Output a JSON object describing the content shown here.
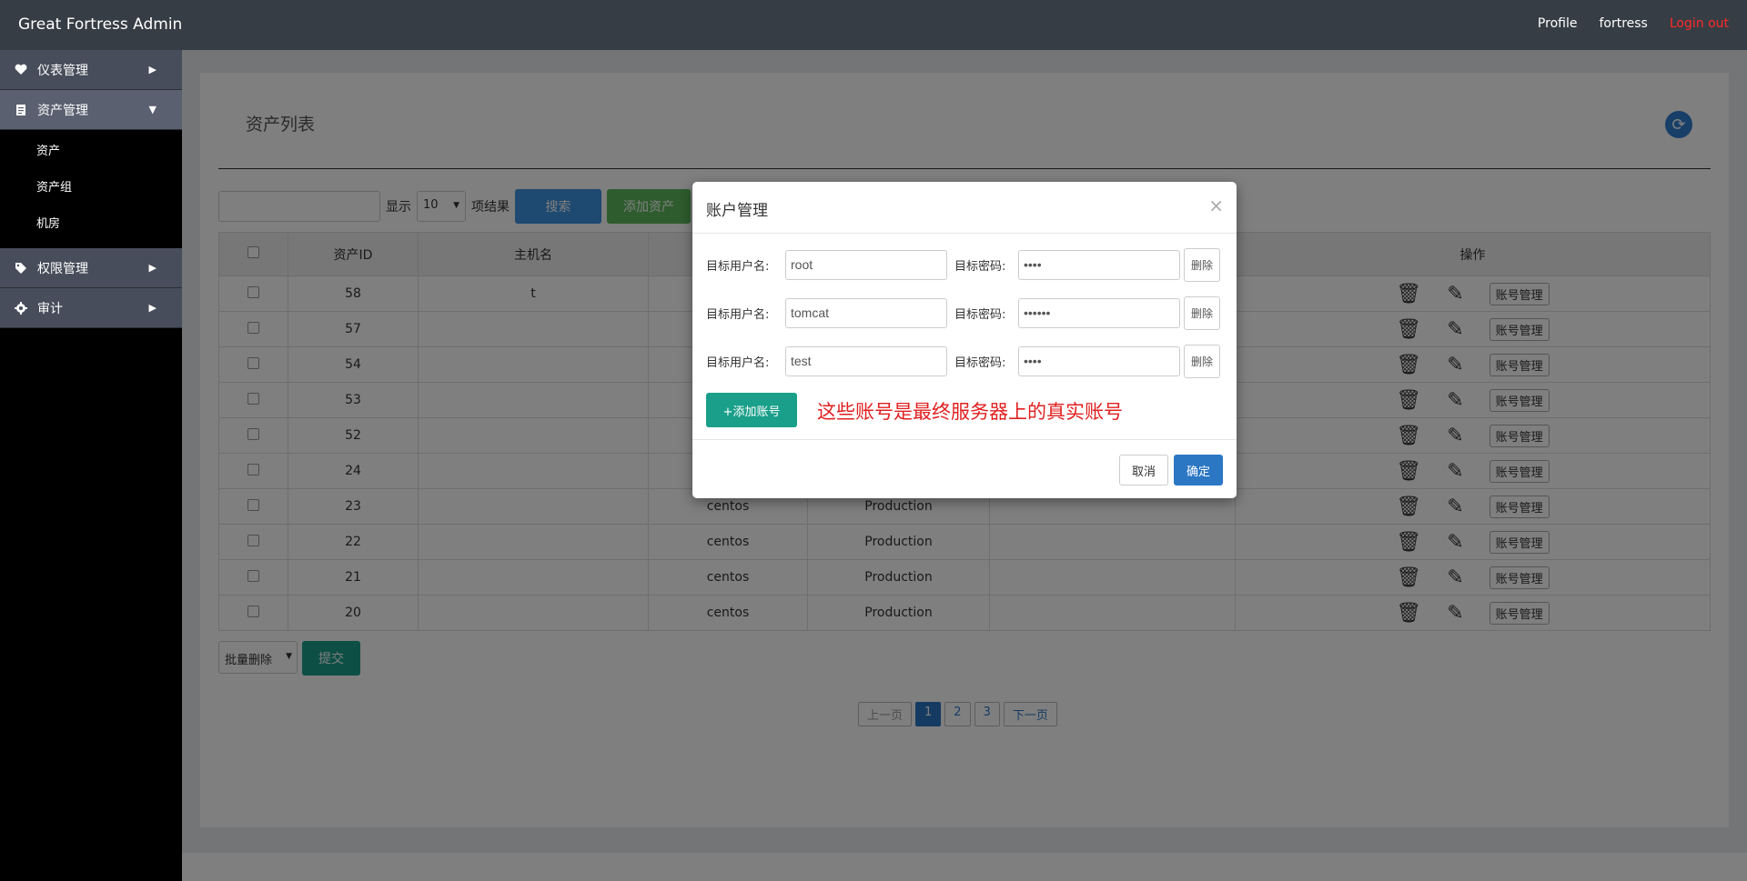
{
  "app": {
    "brand": "Great Fortress Admin"
  },
  "topnav": {
    "profile": "Profile",
    "user": "fortress",
    "logout": "Login out"
  },
  "sidebar": {
    "dashboard": "仪表管理",
    "assets": "资产管理",
    "assets_sub": [
      "资产",
      "资产组",
      "机房"
    ],
    "permissions": "权限管理",
    "audit": "审计"
  },
  "panel": {
    "title": "资产列表"
  },
  "toolbar": {
    "show_label": "显示",
    "page_size": "10",
    "results_label": "项结果",
    "search_button": "搜索",
    "add_asset_button": "添加资产"
  },
  "table": {
    "headers": {
      "id": "资产ID",
      "hostname": "主机名",
      "ops": "操作"
    },
    "rows": [
      {
        "id": "58",
        "hostname": "t",
        "os": "",
        "env": ""
      },
      {
        "id": "57",
        "hostname": "",
        "os": "",
        "env": ""
      },
      {
        "id": "54",
        "hostname": "",
        "os": "",
        "env": ""
      },
      {
        "id": "53",
        "hostname": "",
        "os": "",
        "env": ""
      },
      {
        "id": "52",
        "hostname": "",
        "os": "",
        "env": ""
      },
      {
        "id": "24",
        "hostname": "",
        "os": "",
        "env": ""
      },
      {
        "id": "23",
        "hostname": "",
        "os": "centos",
        "env": "Production"
      },
      {
        "id": "22",
        "hostname": "",
        "os": "centos",
        "env": "Production"
      },
      {
        "id": "21",
        "hostname": "",
        "os": "centos",
        "env": "Production"
      },
      {
        "id": "20",
        "hostname": "",
        "os": "centos",
        "env": "Production"
      }
    ],
    "account_button": "账号管理"
  },
  "bulk": {
    "select": "批量删除",
    "submit": "提交"
  },
  "pager": {
    "prev": "上一页",
    "pages": [
      "1",
      "2",
      "3"
    ],
    "next": "下一页",
    "current": "1"
  },
  "modal": {
    "title": "账户管理",
    "close": "×",
    "user_label": "目标用户名:",
    "pass_label": "目标密码:",
    "accounts": [
      {
        "user": "root",
        "password": "••••"
      },
      {
        "user": "tomcat",
        "password": "••••••"
      },
      {
        "user": "test",
        "password": "••••"
      }
    ],
    "delete": "删除",
    "add_account": "+添加账号",
    "note": "这些账号是最终服务器上的真实账号",
    "cancel": "取消",
    "ok": "确定"
  }
}
